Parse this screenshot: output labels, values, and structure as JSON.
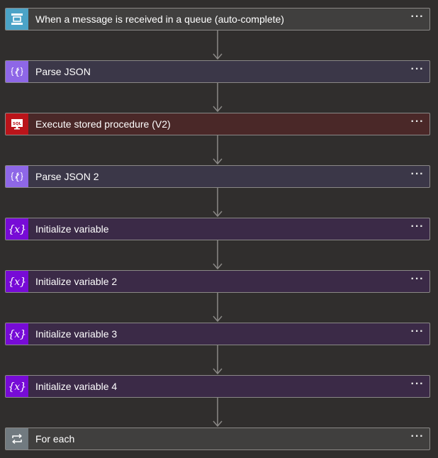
{
  "steps": [
    {
      "title": "When a message is received in a queue (auto-complete)",
      "icon": "service-bus-queue-icon",
      "icon_bg": "#4ba3c7",
      "body_bg": "#403f3e"
    },
    {
      "title": "Parse JSON",
      "icon": "parse-json-icon",
      "icon_bg": "#8e67e7",
      "body_bg": "#3b3748"
    },
    {
      "title": "Execute stored procedure (V2)",
      "icon": "sql-server-icon",
      "icon_bg": "#ba141a",
      "body_bg": "#4a2828"
    },
    {
      "title": "Parse JSON 2",
      "icon": "parse-json-icon",
      "icon_bg": "#8e67e7",
      "body_bg": "#3b3748"
    },
    {
      "title": "Initialize variable",
      "icon": "variable-icon",
      "icon_bg": "#770bd6",
      "body_bg": "#3b2a47"
    },
    {
      "title": "Initialize variable 2",
      "icon": "variable-icon",
      "icon_bg": "#770bd6",
      "body_bg": "#3b2a47"
    },
    {
      "title": "Initialize variable 3",
      "icon": "variable-icon",
      "icon_bg": "#770bd6",
      "body_bg": "#3b2a47"
    },
    {
      "title": "Initialize variable 4",
      "icon": "variable-icon",
      "icon_bg": "#770bd6",
      "body_bg": "#3b2a47"
    },
    {
      "title": "For each",
      "icon": "for-each-loop-icon",
      "icon_bg": "#717a80",
      "body_bg": "#403f3e"
    }
  ],
  "more_label": "···",
  "colors": {
    "canvas": "#302e2d",
    "connector": "#8a8886",
    "step_border": "#8a8886"
  }
}
